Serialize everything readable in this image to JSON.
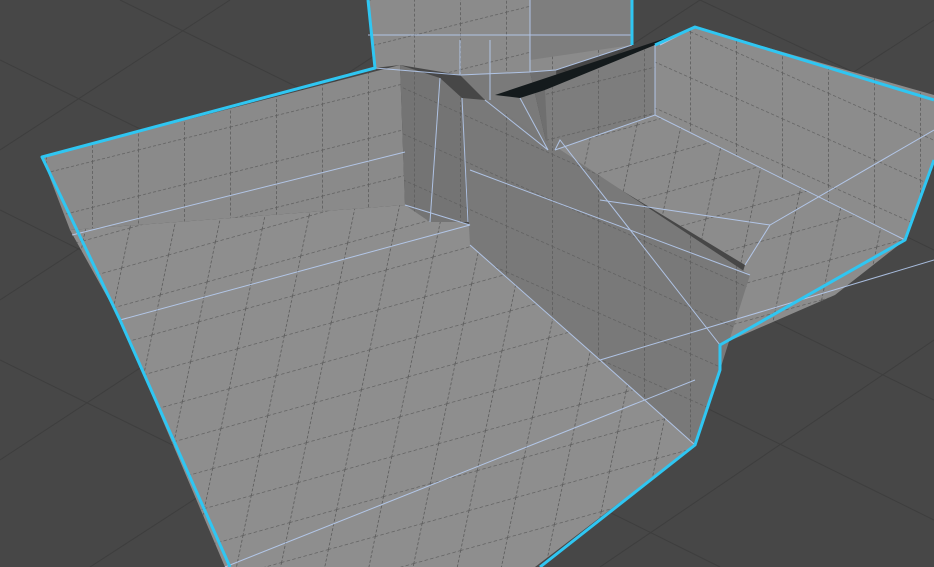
{
  "viewport": {
    "background_color": "#474747",
    "grid_line_color": "#3d3d3d",
    "selection_outline_color": "#2ec4f0",
    "wireframe_edge_color": "#b8cff5",
    "face_colors": {
      "floor": "#8f8f8f",
      "wall_lit": "#868686",
      "wall_shadow": "#767676",
      "wall_dark": "#6a6a6a",
      "sliver": "#151a1c"
    },
    "checker_line_color": "#5a5a5a",
    "icons": [
      "mesh-selection-outline-icon"
    ]
  }
}
